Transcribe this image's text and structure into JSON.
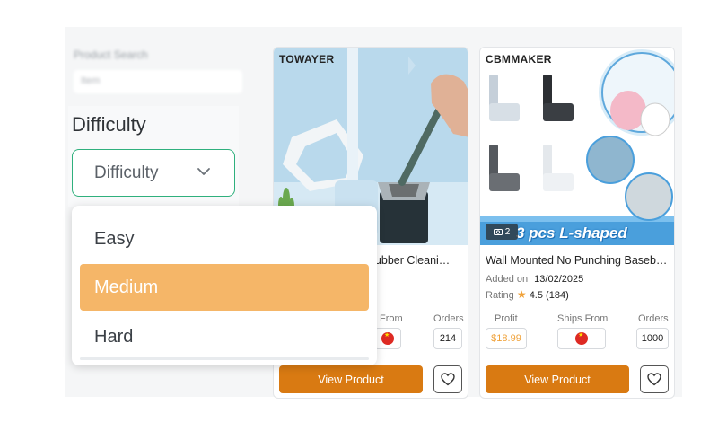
{
  "filters": {
    "product_search_label": "Product Search",
    "product_search_placeholder": "Item",
    "difficulty_title": "Difficulty",
    "difficulty_select_value": "Difficulty",
    "difficulty_options": [
      "Easy",
      "Medium",
      "Hard"
    ],
    "highlighted_option": "Medium"
  },
  "columns": {
    "profit": "Profit",
    "ships_from": "Ships From",
    "orders": "Orders"
  },
  "products": [
    {
      "brand": "TOWAYER",
      "title": "…crubber Cleani…",
      "ships_from_fragment": "From",
      "orders": "214",
      "view_button": "View Product"
    },
    {
      "brand": "CBMMAKER",
      "banner_text": "3 pcs  L-shaped",
      "image_count": "2",
      "title": "Wall Mounted No Punching Baseb…",
      "added_on_label": "Added on",
      "added_on_value": "13/02/2025",
      "rating_label": "Rating",
      "rating_value": "4.5",
      "rating_count": "(184)",
      "profit": "$18.99",
      "orders": "1000",
      "view_button": "View Product"
    }
  ],
  "colors": {
    "accent_orange": "#d97a12",
    "select_border": "#2fb07d",
    "highlight": "#f5b668"
  }
}
